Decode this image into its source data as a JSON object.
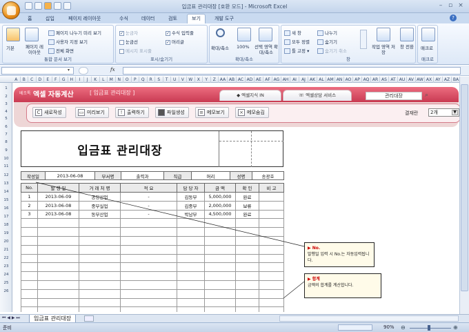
{
  "window": {
    "title": "입금표 관리대장 [호환 모드] - Microsoft Excel"
  },
  "ribbon_tabs": [
    "홈",
    "삽입",
    "페이지 레이아웃",
    "수식",
    "데이터",
    "검토",
    "보기",
    "개발 도구"
  ],
  "ribbon_active_tab": "보기",
  "ribbon": {
    "workbook_views": {
      "label": "통합 문서 보기",
      "normal": "기본",
      "page_layout": "페이지 레이아웃",
      "page_break": "페이지 나누기 미리 보기",
      "custom_views": "사용자 지정 보기",
      "full_screen": "전체 화면"
    },
    "show_hide": {
      "label": "표시/숨기기",
      "ruler": "눈금자",
      "formula_bar": "수식 입력줄",
      "gridlines": "눈금선",
      "headings": "머리글",
      "message_bar": "메시지 표시줄"
    },
    "zoom": {
      "label": "확대/축소",
      "zoom": "확대/축소",
      "pct": "100%",
      "selection": "선택 영역 확대/축소"
    },
    "window": {
      "label": "창",
      "new_window": "새 창",
      "arrange_all": "모두 정렬",
      "freeze": "틀 고정",
      "split": "나누기",
      "hide": "숨기기",
      "unhide": "숨기기 취소",
      "save_workspace": "작업 영역 저장",
      "switch_windows": "창 전환"
    },
    "macros": {
      "label": "매크로",
      "macros": "매크로"
    }
  },
  "formula_bar": {
    "fx": "fx",
    "name_box": "",
    "content": ""
  },
  "columns": [
    "A",
    "B",
    "C",
    "D",
    "E",
    "F",
    "G",
    "H",
    "I",
    "J",
    "K",
    "L",
    "M",
    "N",
    "O",
    "P",
    "Q",
    "R",
    "S",
    "T",
    "U",
    "V",
    "W",
    "X",
    "Y",
    "Z",
    "AA",
    "AB",
    "AC",
    "AD",
    "AE",
    "AF",
    "AG",
    "AH",
    "AI",
    "AJ",
    "AK",
    "AL",
    "AM",
    "AN",
    "AO",
    "AP",
    "AQ",
    "AR",
    "AS",
    "AT",
    "AU",
    "AV",
    "AW",
    "AX",
    "AY",
    "AZ",
    "BA",
    "BB",
    "BC",
    "BE"
  ],
  "rows": [
    "1",
    "2",
    "3",
    "4",
    "5",
    "6",
    "7",
    "8",
    "9",
    "10",
    "11",
    "12",
    "13",
    "14",
    "15",
    "16",
    "17",
    "18",
    "19",
    "20",
    "21",
    "22",
    "23",
    "24",
    "25",
    "26"
  ],
  "app_header": {
    "brand_small": "베조톡",
    "brand": "엑셀 자동계산",
    "subtitle": "[ 입금표 관리대장 ]",
    "tab1": "엑셀지식 IN",
    "tab2": "엑셀상담 서비스",
    "search_value": "관리대장",
    "buttons": [
      "새로작성",
      "미리보기",
      "출력하기",
      "파일생성",
      "메모보기",
      "메모숨김"
    ],
    "approval_label": "결재란",
    "approval_value": "2개"
  },
  "document": {
    "title": "입금표 관리대장",
    "info": {
      "date_label": "작성일",
      "date": "2013-06-08",
      "dept_label": "부서명",
      "dept": "출력과",
      "rank_label": "직급",
      "rank": "머리",
      "name_label": "성명",
      "name": "송광호"
    },
    "headers": [
      "No.",
      "발 행 일",
      "거 래 처 명",
      "적 요",
      "담 당 자",
      "금 액",
      "확 인",
      "비 고"
    ],
    "rows": [
      [
        "1",
        "2013-06-09",
        "공장산업",
        "-",
        "김동부",
        "5,000,000",
        "완료",
        ""
      ],
      [
        "2",
        "2013-06-08",
        "중부실업",
        "-",
        "김중부",
        "2,000,000",
        "보류",
        ""
      ],
      [
        "3",
        "2013-06-08",
        "동부산업",
        "-",
        "박남부",
        "4,500,000",
        "완료",
        ""
      ]
    ]
  },
  "callouts": [
    {
      "title": "▶ No.",
      "text": "발행일 입력 시 No.는 자동입력됩니다."
    },
    {
      "title": "▶ 합계",
      "text": "금액의 합계를 계산합니다."
    }
  ],
  "sheet_tab": "입금표 관리대장",
  "status": {
    "ready": "준비",
    "zoom": "90%"
  }
}
